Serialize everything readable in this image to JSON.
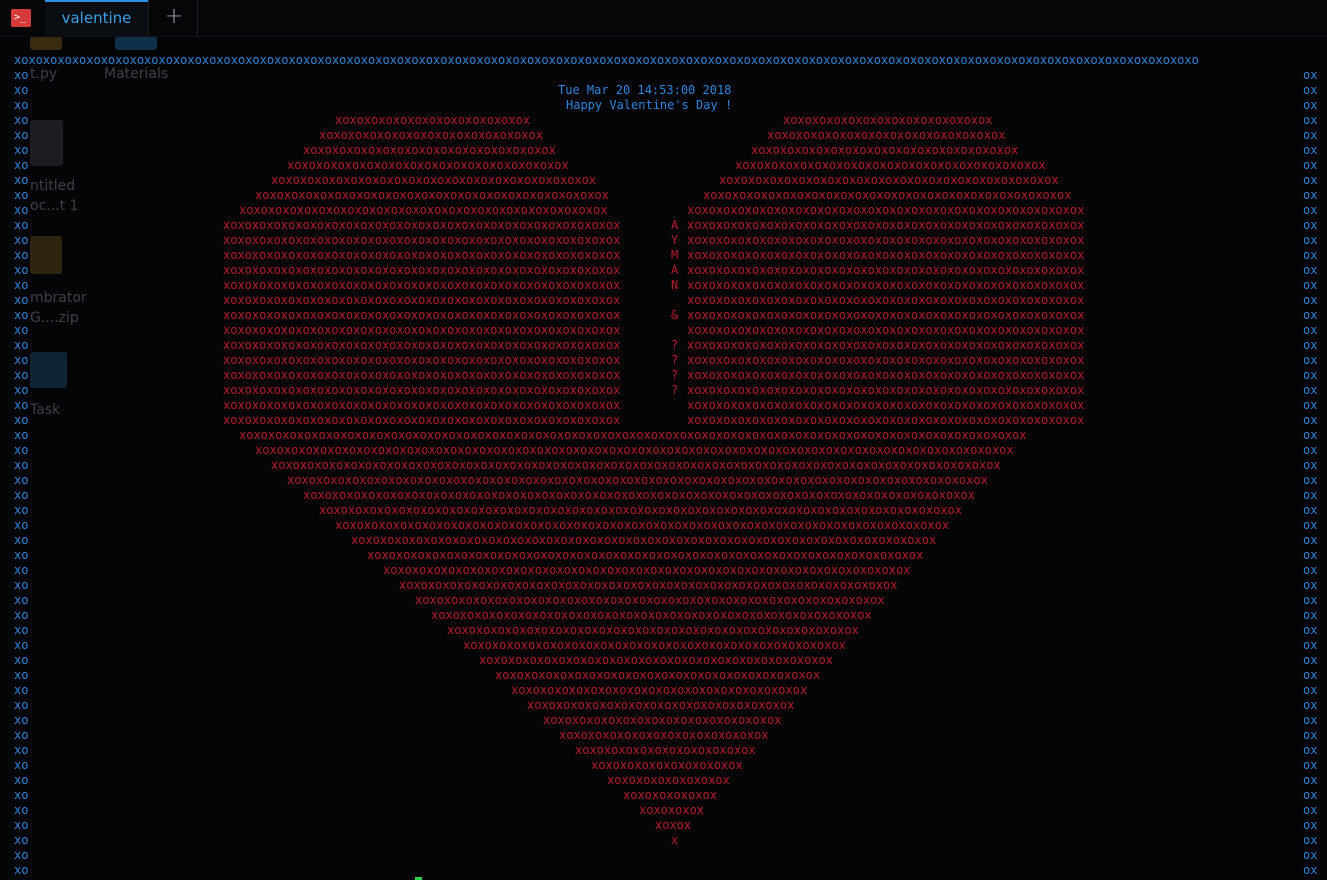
{
  "tabbar": {
    "app_icon": "terminal-icon",
    "app_icon_glyph": ">_",
    "tab_label": "valentine",
    "new_tab_glyph": "+"
  },
  "desktop": {
    "items": [
      "t.py",
      "Materials",
      "ntitled",
      "oc...t 1",
      "mbrator",
      "G....zip",
      "Task"
    ]
  },
  "terminal": {
    "date": "Tue Mar 20 14:53:00 2018",
    "greeting": "Happy Valentine's Day !",
    "initials": [
      "A",
      "Y",
      "M",
      "A",
      "N",
      "",
      "&",
      "",
      "?",
      "?",
      "?",
      "?"
    ],
    "border_top": "xoxoxoxoxoxoxoxoxoxoxoxoxoxoxoxoxoxoxoxoxoxoxoxoxoxoxoxoxoxoxoxoxoxoxoxoxoxoxoxoxoxoxoxoxoxoxoxoxoxoxoxoxoxoxoxoxoxoxoxoxoxoxoxoxoxoxoxoxoxoxoxoxoxoxoxoxoxoxoxoxoxoxo",
    "border_left": "xo",
    "border_right": "ox",
    "heart_pattern": "xoxoxoxoxoxoxoxoxoxoxoxoxoxoxoxoxoxoxoxoxoxoxoxoxoxoxoxoxoxoxoxoxoxoxo"
  },
  "colors": {
    "border": "#2f84d8",
    "heart": "#b31d2a",
    "accent": "#2f8fe0",
    "cursor": "#33d14a"
  }
}
